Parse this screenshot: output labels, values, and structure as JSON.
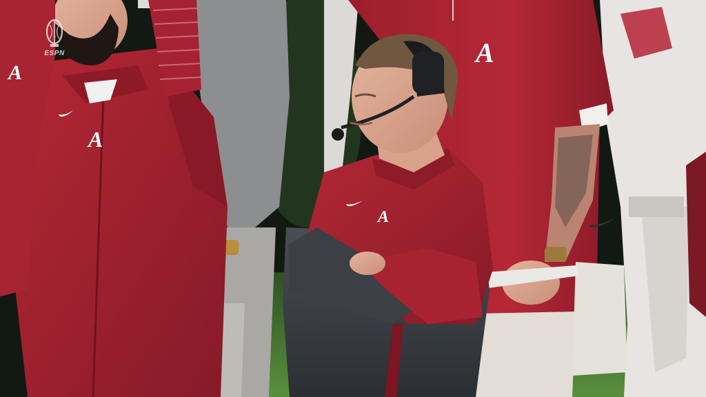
{
  "broadcast": {
    "network_logo": "ESPN",
    "event_logo": "playoff-trophy-icon"
  },
  "colors": {
    "crimson": "#a41f2e",
    "crimson_dark": "#7d1522",
    "jacket_gray": "#3b3f44",
    "field_green": "#4d7e36",
    "white_jersey": "#e9e6e3"
  }
}
